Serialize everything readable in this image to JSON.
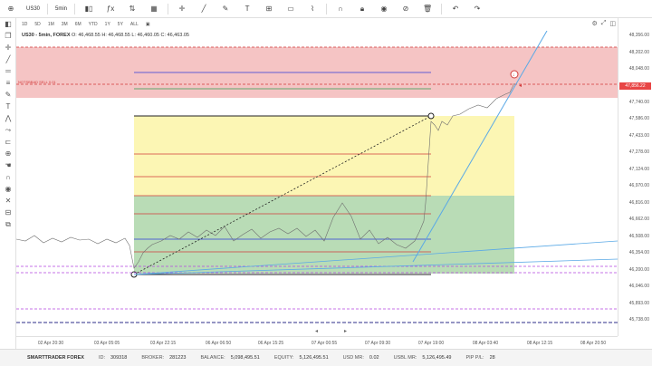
{
  "toolbar": {
    "symbol": "US30",
    "timeframe": "5min",
    "icons": [
      "add-icon",
      "timeframe-icon",
      "candle-type-icon",
      "indicator-icon",
      "compare-icon",
      "layout-icon",
      "line-tool-icon",
      "pen-icon",
      "text-icon",
      "measure-icon",
      "shape-icon",
      "pattern-icon",
      "magnet-icon",
      "lock-icon",
      "visibility-icon",
      "hide-icon",
      "trash-icon",
      "undo-icon",
      "redo-icon"
    ]
  },
  "ranges": [
    "1D",
    "5D",
    "1M",
    "3M",
    "6M",
    "YTD",
    "1Y",
    "5Y",
    "ALL"
  ],
  "legend": {
    "symbol": "US30 - 5min, FOREX",
    "ohlc": "O: 46,468.55  H: 46,468.55  L: 46,460.05  C: 46,463.05"
  },
  "order_label": "NOTSBBAD SELL 0.01",
  "price_labels": [
    "48,356.00",
    "48,202.00",
    "48,048.00",
    "47,894.00",
    "47,740.00",
    "47,586.00",
    "47,433.00",
    "47,278.00",
    "47,124.00",
    "46,970.00",
    "46,816.00",
    "46,662.00",
    "46,508.00",
    "46,354.00",
    "46,200.00",
    "46,046.00",
    "45,893.00",
    "45,738.00"
  ],
  "current_price": "47,856.22",
  "time_labels": [
    "02 Apr 20:30",
    "03 Apr 05:05",
    "03 Apr 22:15",
    "06 Apr 06:50",
    "06 Apr 15:25",
    "07 Apr 00:55",
    "07 Apr 09:30",
    "07 Apr 19:00",
    "08 Apr 03:40",
    "08 Apr 12:15",
    "08 Apr 20:50"
  ],
  "status": {
    "brand": "SMARTTRADER FOREX",
    "id_label": "ID:",
    "id_value": "309318",
    "broker_label": "BROKER:",
    "broker_value": "281223",
    "balance_label": "BALANCE:",
    "balance_value": "5,098,495.51",
    "equity_label": "EQUITY:",
    "equity_value": "5,126,495.51",
    "usd_mr_label": "USD MR:",
    "usd_mr_value": "0.02",
    "usbl_mr_label": "USBL MR:",
    "usbl_mr_value": "5,126,495.49",
    "pip_label": "PIP P/L:",
    "pip_value": "28"
  },
  "colors": {
    "sell_zone": "#f5c4c4",
    "yellow_zone": "#fcf6b4",
    "green_zone": "#b9dcb6",
    "price_line": "#5aa9e6",
    "red_level": "#d23b3b",
    "blue_level": "#2f3bd9",
    "purple_level": "#b445e0",
    "navy_level": "#2c2c8a"
  }
}
